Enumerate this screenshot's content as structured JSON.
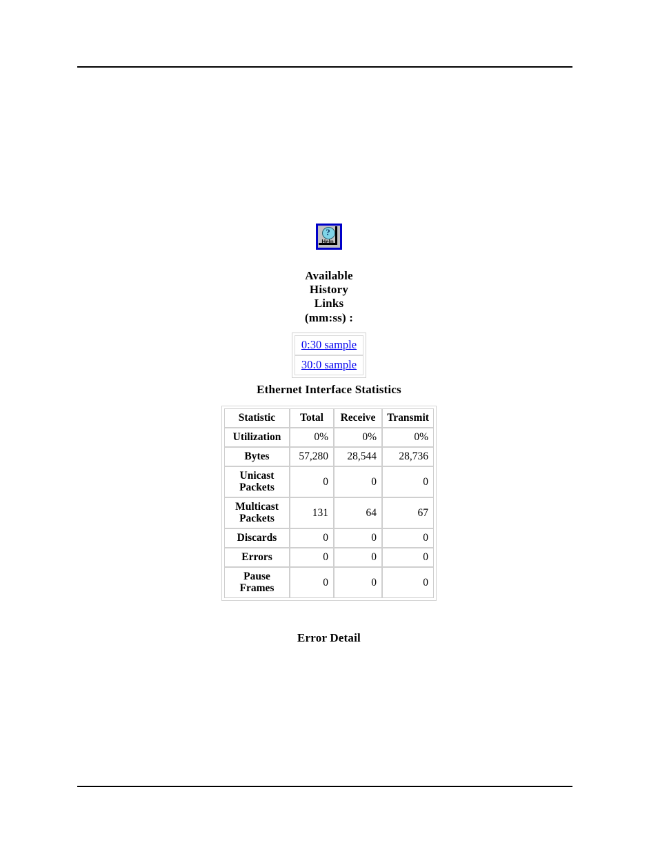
{
  "page": {
    "background": "#ffffff",
    "rules": [
      "top-rule",
      "bottom-rule"
    ]
  },
  "help_button": {
    "icon": "help-question-icon",
    "label": "Help",
    "question_mark": "?",
    "border_color": "#0000c8",
    "face_color": "#c0c0c0",
    "bubble_color": "#7fd4e8"
  },
  "history": {
    "heading_lines": [
      "Available",
      "History",
      "Links",
      "(mm:ss) :"
    ],
    "links": [
      {
        "label": "0:30 sample"
      },
      {
        "label": "30:0 sample"
      }
    ],
    "link_color": "#0000ee"
  },
  "stats_section": {
    "title": "Ethernet Interface Statistics",
    "footer_title": "Error Detail",
    "columns": [
      "Statistic",
      "Total",
      "Receive",
      "Transmit"
    ],
    "rows": [
      {
        "statistic": "Utilization",
        "total": "0%",
        "receive": "0%",
        "transmit": "0%"
      },
      {
        "statistic": "Bytes",
        "total": "57,280",
        "receive": "28,544",
        "transmit": "28,736"
      },
      {
        "statistic": "Unicast Packets",
        "total": "0",
        "receive": "0",
        "transmit": "0"
      },
      {
        "statistic": "Multicast Packets",
        "total": "131",
        "receive": "64",
        "transmit": "67"
      },
      {
        "statistic": "Discards",
        "total": "0",
        "receive": "0",
        "transmit": "0"
      },
      {
        "statistic": "Errors",
        "total": "0",
        "receive": "0",
        "transmit": "0"
      },
      {
        "statistic": "Pause Frames",
        "total": "0",
        "receive": "0",
        "transmit": "0"
      }
    ]
  }
}
